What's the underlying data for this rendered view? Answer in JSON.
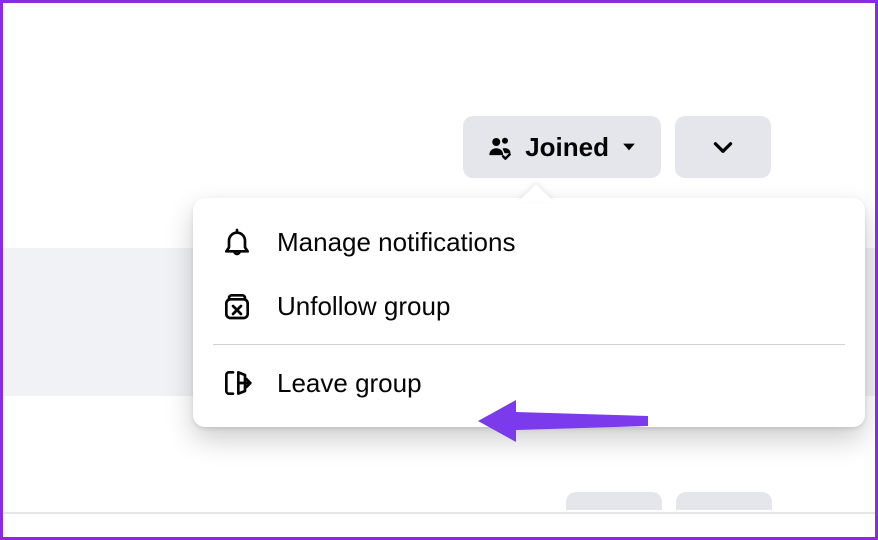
{
  "colors": {
    "frame": "#8a2be2",
    "button_bg": "#e4e6eb",
    "text": "#050505",
    "arrow": "#7c3aed"
  },
  "buttons": {
    "joined_label": "Joined"
  },
  "menu": {
    "manage_notifications": "Manage notifications",
    "unfollow_group": "Unfollow group",
    "leave_group": "Leave group"
  }
}
